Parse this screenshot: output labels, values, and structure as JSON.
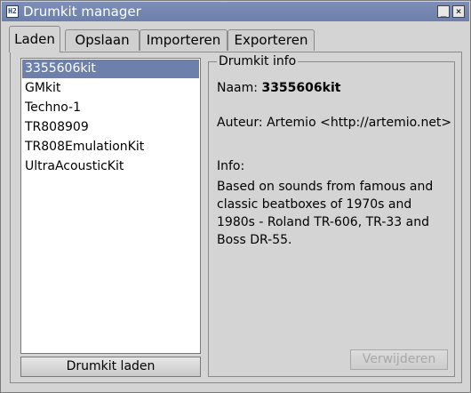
{
  "window": {
    "title": "Drumkit manager",
    "icon_text": "H2",
    "minimize_glyph": "_",
    "close_glyph": "×"
  },
  "tabs": [
    {
      "label": "Laden",
      "active": true
    },
    {
      "label": "Opslaan",
      "active": false
    },
    {
      "label": "Importeren",
      "active": false
    },
    {
      "label": "Exporteren",
      "active": false
    }
  ],
  "kit_list": {
    "items": [
      "3355606kit",
      "GMkit",
      "Techno-1",
      "TR808909",
      "TR808EmulationKit",
      "UltraAcousticKit"
    ],
    "selected": "3355606kit"
  },
  "load_button_label": "Drumkit laden",
  "info": {
    "group_title": "Drumkit info",
    "name_label": "Naam:",
    "name_value": "3355606kit",
    "author_label": "Auteur:",
    "author_value": "Artemio <http://artemio.net>",
    "info_label": "Info:",
    "info_text": "Based on sounds from famous and classic beatboxes of 1970s and 1980s - Roland TR-606, TR-33 and Boss DR-55."
  },
  "delete_button_label": "Verwijderen",
  "colors": {
    "titlebar": "#6d80ab",
    "selection": "#6d80ab",
    "window_bg": "#d4d4d4"
  }
}
